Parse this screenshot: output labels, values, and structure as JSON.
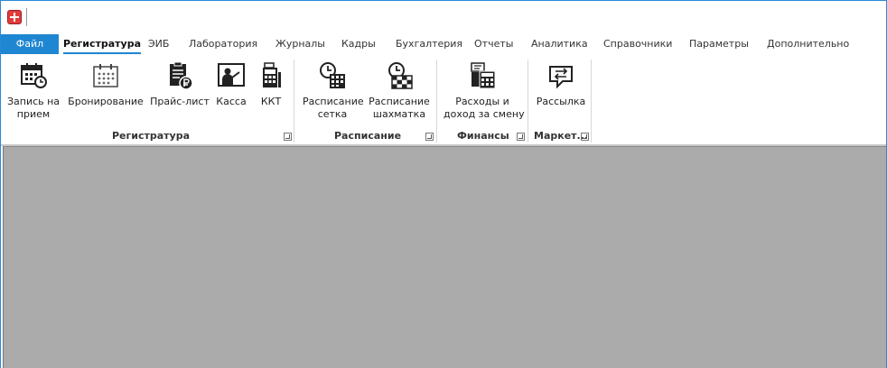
{
  "tabs": [
    {
      "label": "Файл"
    },
    {
      "label": "Регистратура"
    },
    {
      "label": "ЭИБ"
    },
    {
      "label": "Лаборатория"
    },
    {
      "label": "Журналы"
    },
    {
      "label": "Кадры"
    },
    {
      "label": "Бухгалтерия"
    },
    {
      "label": "Отчеты"
    },
    {
      "label": "Аналитика"
    },
    {
      "label": "Справочники"
    },
    {
      "label": "Параметры"
    },
    {
      "label": "Дополнительно"
    }
  ],
  "ribbon": {
    "groups": [
      {
        "label": "Регистратура",
        "buttons": [
          {
            "line1": "Запись на",
            "line2": "прием",
            "icon": "calendar-clock-icon"
          },
          {
            "line1": "Бронирование",
            "line2": "",
            "icon": "calendar-dots-icon"
          },
          {
            "line1": "Прайс-лист",
            "line2": "",
            "icon": "price-list-ruble-icon"
          },
          {
            "line1": "Касса",
            "line2": "",
            "icon": "cashier-icon"
          },
          {
            "line1": "ККТ",
            "line2": "",
            "icon": "cash-register-icon"
          }
        ]
      },
      {
        "label": "Расписание",
        "buttons": [
          {
            "line1": "Расписание",
            "line2": "сетка",
            "icon": "schedule-grid-icon"
          },
          {
            "line1": "Расписание",
            "line2": "шахматка",
            "icon": "schedule-chess-icon"
          }
        ]
      },
      {
        "label": "Финансы",
        "buttons": [
          {
            "line1": "Расходы и",
            "line2": "доход за смену",
            "icon": "calculator-icon"
          }
        ]
      },
      {
        "label": "Маркет...",
        "buttons": [
          {
            "line1": "Рассылка",
            "line2": "",
            "icon": "mailing-icon"
          }
        ]
      }
    ]
  }
}
